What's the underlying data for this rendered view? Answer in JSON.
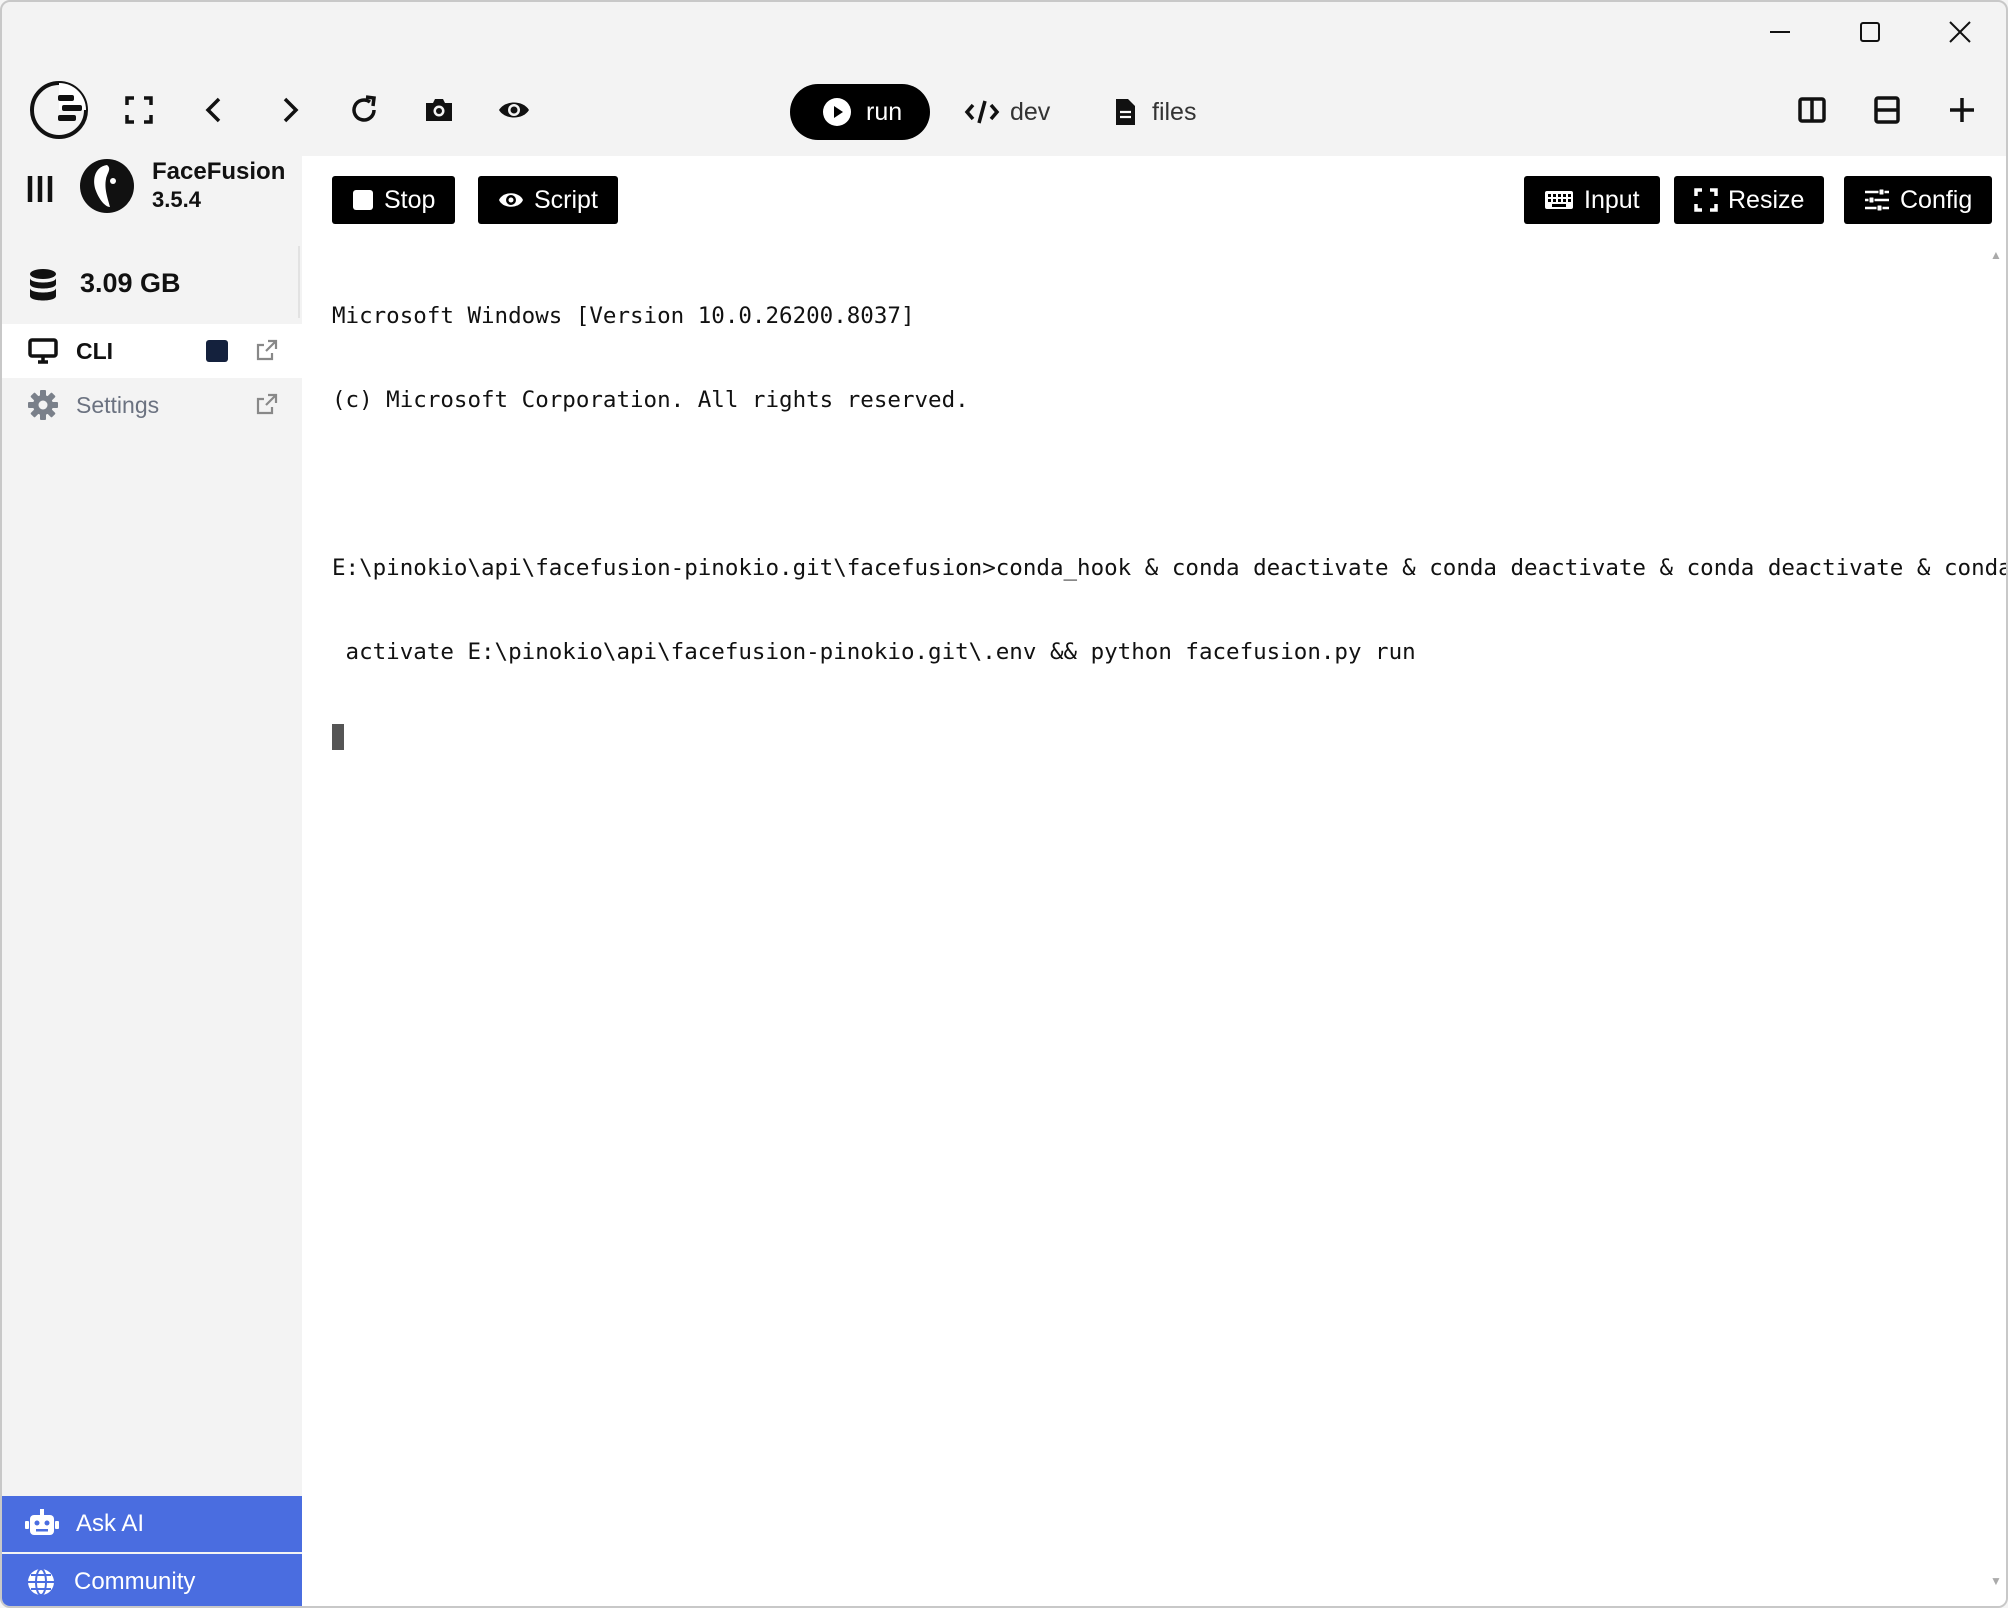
{
  "window": {
    "controls": [
      "minimize",
      "maximize",
      "close"
    ]
  },
  "toolbar": {
    "tabs": {
      "run": "run",
      "dev": "dev",
      "files": "files"
    }
  },
  "app": {
    "name": "FaceFusion",
    "version": "3.5.4",
    "disk_usage": "3.09 GB"
  },
  "sidebar": {
    "items": [
      {
        "label": "CLI"
      },
      {
        "label": "Settings"
      }
    ],
    "bottom": [
      {
        "label": "Ask AI"
      },
      {
        "label": "Community"
      }
    ]
  },
  "actions": {
    "stop": "Stop",
    "script": "Script",
    "input": "Input",
    "resize": "Resize",
    "config": "Config"
  },
  "terminal": {
    "lines": [
      "Microsoft Windows [Version 10.0.26200.8037]",
      "(c) Microsoft Corporation. All rights reserved.",
      "",
      "E:\\pinokio\\api\\facefusion-pinokio.git\\facefusion>conda_hook & conda deactivate & conda deactivate & conda deactivate & conda",
      " activate E:\\pinokio\\api\\facefusion-pinokio.git\\.env && python facefusion.py run"
    ]
  }
}
